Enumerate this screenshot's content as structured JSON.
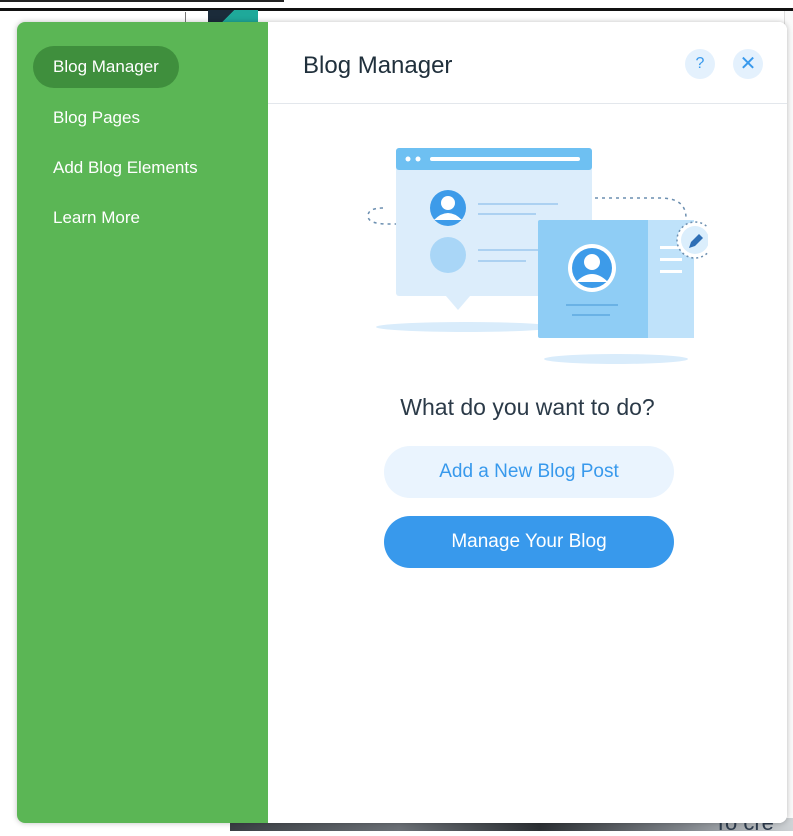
{
  "sidebar": {
    "items": [
      {
        "label": "Blog Manager",
        "active": true
      },
      {
        "label": "Blog Pages",
        "active": false
      },
      {
        "label": "Add Blog Elements",
        "active": false
      },
      {
        "label": "Learn More",
        "active": false
      }
    ]
  },
  "header": {
    "title": "Blog Manager",
    "help_label": "?",
    "close_label": "✕"
  },
  "main": {
    "question": "What do you want to do?",
    "secondary_button": "Add a New Blog Post",
    "primary_button": "Manage Your Blog"
  },
  "background": {
    "partial_text": "To cre"
  },
  "colors": {
    "sidebar": "#5bb655",
    "sidebar_active": "#3f8f3d",
    "accent": "#3899ec",
    "accent_light": "#eaf4fe"
  },
  "icons": [
    "help-icon",
    "close-icon",
    "profile-card-illustration",
    "edit-pencil-icon"
  ]
}
